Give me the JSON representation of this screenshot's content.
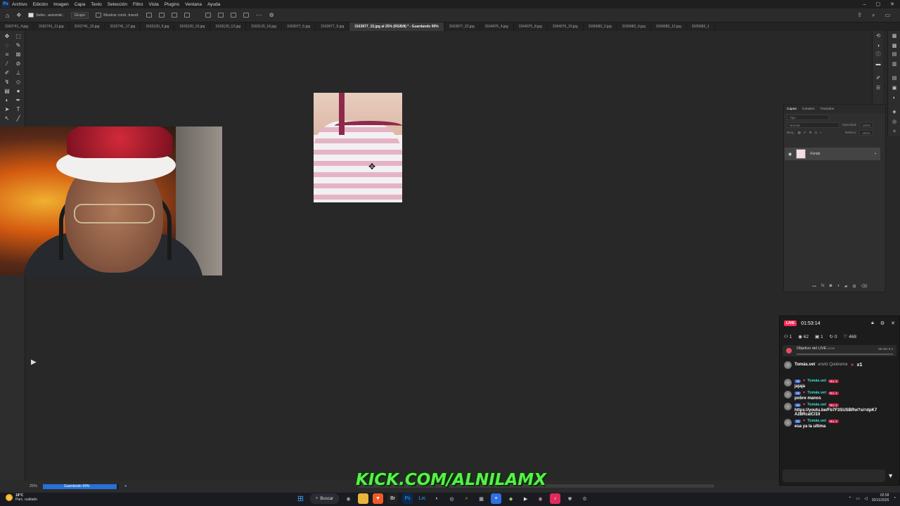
{
  "menubar": {
    "logo": "Ps",
    "items": [
      "Archivo",
      "Edición",
      "Imagen",
      "Capa",
      "Texto",
      "Selección",
      "Filtro",
      "Vista",
      "Plugins",
      "Ventana",
      "Ayuda"
    ]
  },
  "options": {
    "auto_select": "Selec. automát.:",
    "group": "Grupo",
    "transform": "Mostrar contr. transf."
  },
  "tabs": [
    {
      "label": "3162741_4.jpg",
      "active": false
    },
    {
      "label": "3162741_11.jpg",
      "active": false
    },
    {
      "label": "3162741_16.jpg",
      "active": false
    },
    {
      "label": "3162741_17.jpg",
      "active": false
    },
    {
      "label": "3163120_5.jpg",
      "active": false
    },
    {
      "label": "3163120_10.jpg",
      "active": false
    },
    {
      "label": "3163120_12.jpg",
      "active": false
    },
    {
      "label": "3163120_16.jpg",
      "active": false
    },
    {
      "label": "3163977_5.jpg",
      "active": false
    },
    {
      "label": "3163977_9.jpg",
      "active": false
    },
    {
      "label": "3163977_15.jpg al 25% (RGB/8) * - Guardando 99%",
      "active": true
    },
    {
      "label": "3163977_22.jpg",
      "active": false
    },
    {
      "label": "3164075_4.jpg",
      "active": false
    },
    {
      "label": "3164075_8.jpg",
      "active": false
    },
    {
      "label": "3164075_15.jpg",
      "active": false
    },
    {
      "label": "3165683_2.jpg",
      "active": false
    },
    {
      "label": "3165683_9.jpg",
      "active": false
    },
    {
      "label": "3165683_12.jpg",
      "active": false
    },
    {
      "label": "3165683_1",
      "active": false
    }
  ],
  "layers_panel": {
    "tabs": [
      "Capas",
      "Canales",
      "Trazados"
    ],
    "filter_placeholder": "Tipo",
    "blend_mode": "Normal",
    "opacity_label": "Opacidad:",
    "opacity_value": "100%",
    "lock_label": "Bloq.:",
    "fill_label": "Relleno:",
    "fill_value": "100%",
    "layer_name": "Fondo"
  },
  "status": {
    "zoom": "25%",
    "saving": "Guardando 99%",
    "progress_fraction": 0.97
  },
  "banner": {
    "text": "KICK.COM/ALNILAMX"
  },
  "live": {
    "badge": "LIVE",
    "timer": "01:53:14",
    "stats": {
      "people": "1",
      "views": "62",
      "gifts": "1",
      "shares": "0",
      "likes": "468"
    },
    "goal_title": "Objetivo del LIVE",
    "goal_count": "0/100",
    "goal_time": "59 min 5 s",
    "gift_user": "Tomás.vet",
    "gift_text": "envió Quiéreme",
    "gift_count": "x1",
    "messages": [
      {
        "level": "15",
        "user": "Tomás.vet",
        "badge": "No. 1",
        "text": "jajaja"
      },
      {
        "level": "15",
        "user": "Tomás.vet",
        "badge": "No. 1",
        "text": "pobre manos"
      },
      {
        "level": "15",
        "user": "Tomás.vet",
        "badge": "No. 1",
        "text": "https://youtu.be/Fb7F3SUSBRw?si=dpK7A28RcalCI1Il"
      },
      {
        "level": "15",
        "user": "Tomás.vet",
        "badge": "No. 1",
        "text": "esa ya la ultima"
      }
    ]
  },
  "taskbar": {
    "temp": "18°C",
    "weather": "Parc. nublado",
    "search": "Buscar",
    "time": "02:58",
    "date": "20/11/2025"
  },
  "colors": {
    "accent": "#2770d6",
    "live_badge": "#fe2c55",
    "banner_green": "#58f04a"
  }
}
